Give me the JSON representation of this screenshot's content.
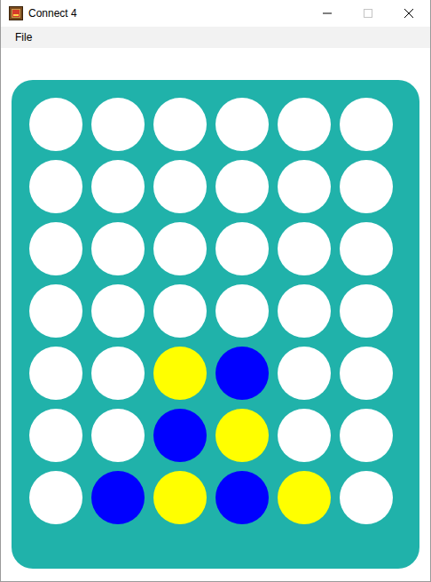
{
  "window": {
    "title": "Connect 4",
    "maximize_disabled": true
  },
  "menu": [
    {
      "label": "File"
    }
  ],
  "board": {
    "rows": [
      [
        {
          "color": "#ffffff"
        },
        {
          "color": "#ffffff"
        },
        {
          "color": "#ffffff"
        },
        {
          "color": "#ffffff"
        },
        {
          "color": "#ffffff"
        },
        {
          "color": "#ffffff"
        }
      ],
      [
        {
          "color": "#ffffff"
        },
        {
          "color": "#ffffff"
        },
        {
          "color": "#ffffff"
        },
        {
          "color": "#ffffff"
        },
        {
          "color": "#ffffff"
        },
        {
          "color": "#ffffff"
        }
      ],
      [
        {
          "color": "#ffffff"
        },
        {
          "color": "#ffffff"
        },
        {
          "color": "#ffffff"
        },
        {
          "color": "#ffffff"
        },
        {
          "color": "#ffffff"
        },
        {
          "color": "#ffffff"
        }
      ],
      [
        {
          "color": "#ffffff"
        },
        {
          "color": "#ffffff"
        },
        {
          "color": "#ffffff"
        },
        {
          "color": "#ffffff"
        },
        {
          "color": "#ffffff"
        },
        {
          "color": "#ffffff"
        }
      ],
      [
        {
          "color": "#ffffff"
        },
        {
          "color": "#ffffff"
        },
        {
          "color": "#ffff00"
        },
        {
          "color": "#0000ff"
        },
        {
          "color": "#ffffff"
        },
        {
          "color": "#ffffff"
        }
      ],
      [
        {
          "color": "#ffffff"
        },
        {
          "color": "#ffffff"
        },
        {
          "color": "#0000ff"
        },
        {
          "color": "#ffff00"
        },
        {
          "color": "#ffffff"
        },
        {
          "color": "#ffffff"
        }
      ],
      [
        {
          "color": "#ffffff"
        },
        {
          "color": "#0000ff"
        },
        {
          "color": "#ffff00"
        },
        {
          "color": "#0000ff"
        },
        {
          "color": "#ffff00"
        },
        {
          "color": "#ffffff"
        }
      ]
    ]
  }
}
